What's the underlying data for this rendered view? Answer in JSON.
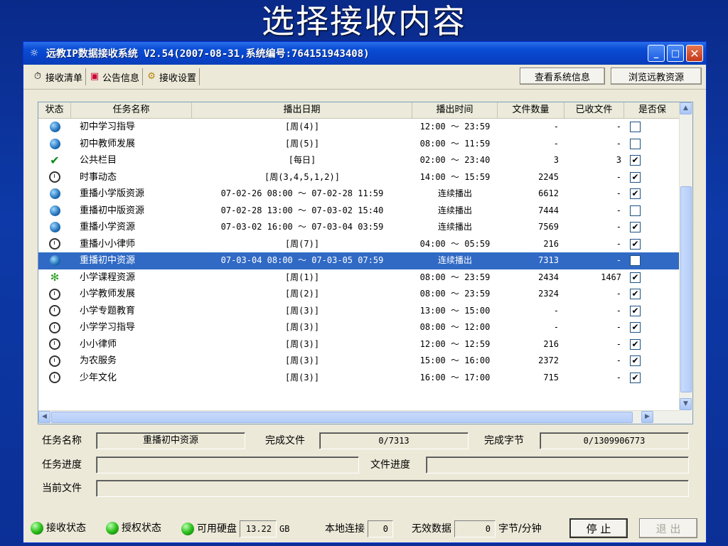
{
  "slide_title": "选择接收内容",
  "window": {
    "title": "远教IP数据接收系统 V2.54(2007-08-31,系统编号:764151943408)",
    "controls": {
      "minimize": "_",
      "maximize": "□",
      "close": "✕"
    }
  },
  "toolbar": {
    "tabs": [
      {
        "icon": "clock-icon",
        "label": "接收清单"
      },
      {
        "icon": "notice-icon",
        "label": "公告信息"
      },
      {
        "icon": "settings-icon",
        "label": "接收设置"
      }
    ],
    "view_system_info": "查看系统信息",
    "browse_resources": "浏览远教资源"
  },
  "list": {
    "columns": [
      "状态",
      "任务名称",
      "播出日期",
      "播出时间",
      "文件数量",
      "已收文件",
      "是否保"
    ],
    "rows": [
      {
        "status": "globe",
        "name": "初中学习指导",
        "date": "[周(4)]",
        "time": "12:00 ～ 23:59",
        "files": "-",
        "received": "-",
        "keep": false
      },
      {
        "status": "globe",
        "name": "初中教师发展",
        "date": "[周(5)]",
        "time": "08:00 ～ 11:59",
        "files": "-",
        "received": "-",
        "keep": false
      },
      {
        "status": "check",
        "name": "公共栏目",
        "date": "[每日]",
        "time": "02:00 ～ 23:40",
        "files": "3",
        "received": "3",
        "keep": true
      },
      {
        "status": "clock",
        "name": "时事动态",
        "date": "[周(3,4,5,1,2)]",
        "time": "14:00 ～ 15:59",
        "files": "2245",
        "received": "-",
        "keep": true
      },
      {
        "status": "globe",
        "name": "重播小学版资源",
        "date": "07-02-26 08:00 ～ 07-02-28 11:59",
        "time": "连续播出",
        "files": "6612",
        "received": "-",
        "keep": true
      },
      {
        "status": "globe",
        "name": "重播初中版资源",
        "date": "07-02-28 13:00 ～ 07-03-02 15:40",
        "time": "连续播出",
        "files": "7444",
        "received": "-",
        "keep": false
      },
      {
        "status": "globe",
        "name": "重播小学资源",
        "date": "07-03-02 16:00 ～ 07-03-04 03:59",
        "time": "连续播出",
        "files": "7569",
        "received": "-",
        "keep": true
      },
      {
        "status": "clock",
        "name": "重播小小律师",
        "date": "[周(7)]",
        "time": "04:00 ～ 05:59",
        "files": "216",
        "received": "-",
        "keep": true
      },
      {
        "status": "globe",
        "name": "重播初中资源",
        "date": "07-03-04 08:00 ～ 07-03-05 07:59",
        "time": "连续播出",
        "files": "7313",
        "received": "-",
        "keep": false,
        "selected": true
      },
      {
        "status": "runner",
        "name": "小学课程资源",
        "date": "[周(1)]",
        "time": "08:00 ～ 23:59",
        "files": "2434",
        "received": "1467",
        "keep": true
      },
      {
        "status": "clock",
        "name": "小学教师发展",
        "date": "[周(2)]",
        "time": "08:00 ～ 23:59",
        "files": "2324",
        "received": "-",
        "keep": true
      },
      {
        "status": "clock",
        "name": "小学专题教育",
        "date": "[周(3)]",
        "time": "13:00 ～ 15:00",
        "files": "-",
        "received": "-",
        "keep": true
      },
      {
        "status": "clock",
        "name": "小学学习指导",
        "date": "[周(3)]",
        "time": "08:00 ～ 12:00",
        "files": "-",
        "received": "-",
        "keep": true
      },
      {
        "status": "clock",
        "name": "小小律师",
        "date": "[周(3)]",
        "time": "12:00 ～ 12:59",
        "files": "216",
        "received": "-",
        "keep": true
      },
      {
        "status": "clock",
        "name": "为农服务",
        "date": "[周(3)]",
        "time": "15:00 ～ 16:00",
        "files": "2372",
        "received": "-",
        "keep": true
      },
      {
        "status": "clock",
        "name": "少年文化",
        "date": "[周(3)]",
        "time": "16:00 ～ 17:00",
        "files": "715",
        "received": "-",
        "keep": true
      }
    ]
  },
  "task": {
    "name_label": "任务名称",
    "name_value": "重播初中资源",
    "done_files_label": "完成文件",
    "done_files_value": "0/7313",
    "done_bytes_label": "完成字节",
    "done_bytes_value": "0/1309906773",
    "progress_label": "任务进度",
    "file_progress_label": "文件进度",
    "current_file_label": "当前文件"
  },
  "status_bar": {
    "recv_state": "接收状态",
    "auth_state": "授权状态",
    "disk_label": "可用硬盘",
    "disk_value": "13.22",
    "disk_unit": "GB",
    "local_conn_label": "本地连接",
    "local_conn_value": "0",
    "invalid_label": "无效数据",
    "invalid_value": "0",
    "rate_unit": "字节/分钟",
    "stop_button": "停 止",
    "exit_button": "退 出"
  }
}
